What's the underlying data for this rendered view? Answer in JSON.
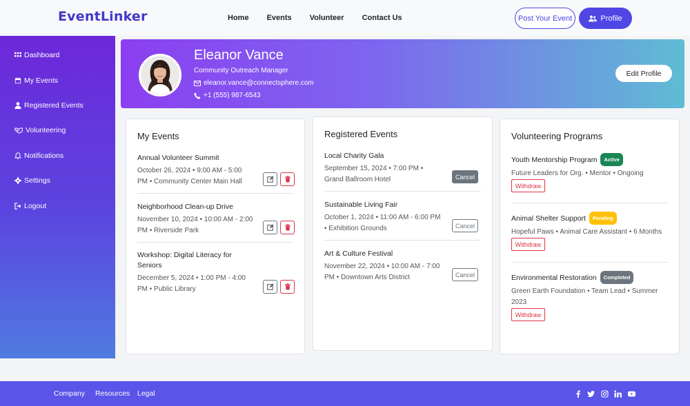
{
  "brand": "EventLinker",
  "nav": {
    "links": [
      "Home",
      "Events",
      "Volunteer",
      "Contact Us"
    ],
    "post_event": "Post Your Event",
    "profile": "Profile"
  },
  "sidebar": {
    "items": [
      "Dashboard",
      "My Events",
      "Registered Events",
      "Volunteering",
      "Notifications",
      "Settings",
      "Logout"
    ]
  },
  "profile": {
    "name": "Eleanor Vance",
    "role": "Community Outreach Manager",
    "email": "eleanor.vance@connectsphere.com",
    "phone": "+1 (555) 987-6543",
    "edit_label": "Edit Profile"
  },
  "my_events": {
    "title": "My Events",
    "items": [
      {
        "title": "Annual Volunteer Summit",
        "line1": "October 26, 2024 • 9:00 AM - 5:00",
        "line2": "PM • Community Center Main Hall"
      },
      {
        "title": "Neighborhood Clean-up Drive",
        "line1": "November 10, 2024 • 10:00 AM - 2:00",
        "line2": "PM • Riverside Park"
      },
      {
        "title": "Workshop: Digital Literacy for",
        "title2": "Seniors",
        "line1": "December 5, 2024 • 1:00 PM - 4:00",
        "line2": "PM • Public Library"
      }
    ]
  },
  "registered_events": {
    "title": "Registered Events",
    "cancel_label": "Cancel",
    "items": [
      {
        "title": "Local Charity Gala",
        "line1": "September 15, 2024 • 7:00 PM •",
        "line2": "Grand Ballroom Hotel"
      },
      {
        "title": "Sustainable Living Fair",
        "line1": "October 1, 2024 • 11:00 AM - 6:00 PM",
        "line2": "• Exhibition Grounds"
      },
      {
        "title": "Art & Culture Festival",
        "line1": "November 22, 2024 • 10:00 AM - 7:00",
        "line2": "PM • Downtown Arts District"
      }
    ]
  },
  "volunteering": {
    "title": "Volunteering Programs",
    "withdraw_label": "Withdraw",
    "items": [
      {
        "title": "Youth Mentorship Program",
        "status": "Active",
        "line1": "Future Leaders for Org. • Mentor • Ongoing",
        "line2": ""
      },
      {
        "title": "Animal Shelter Support",
        "status": "Pending",
        "line1": "Hopeful Paws • Animal Care Assistant • 6 Months",
        "line2": ""
      },
      {
        "title": "Environmental Restoration",
        "status": "Completed",
        "line1": "Green Earth Foundation • Team Lead • Summer",
        "line2": "2023"
      }
    ]
  },
  "footer": {
    "links": [
      "Company",
      "Resources",
      "Legal"
    ],
    "social": [
      "facebook-icon",
      "twitter-icon",
      "instagram-icon",
      "linkedin-icon",
      "youtube-icon"
    ]
  },
  "colors": {
    "accent": "#4f46e5",
    "danger": "#dc3545",
    "success": "#198754",
    "warning": "#ffc107",
    "secondary": "#6c757d"
  }
}
